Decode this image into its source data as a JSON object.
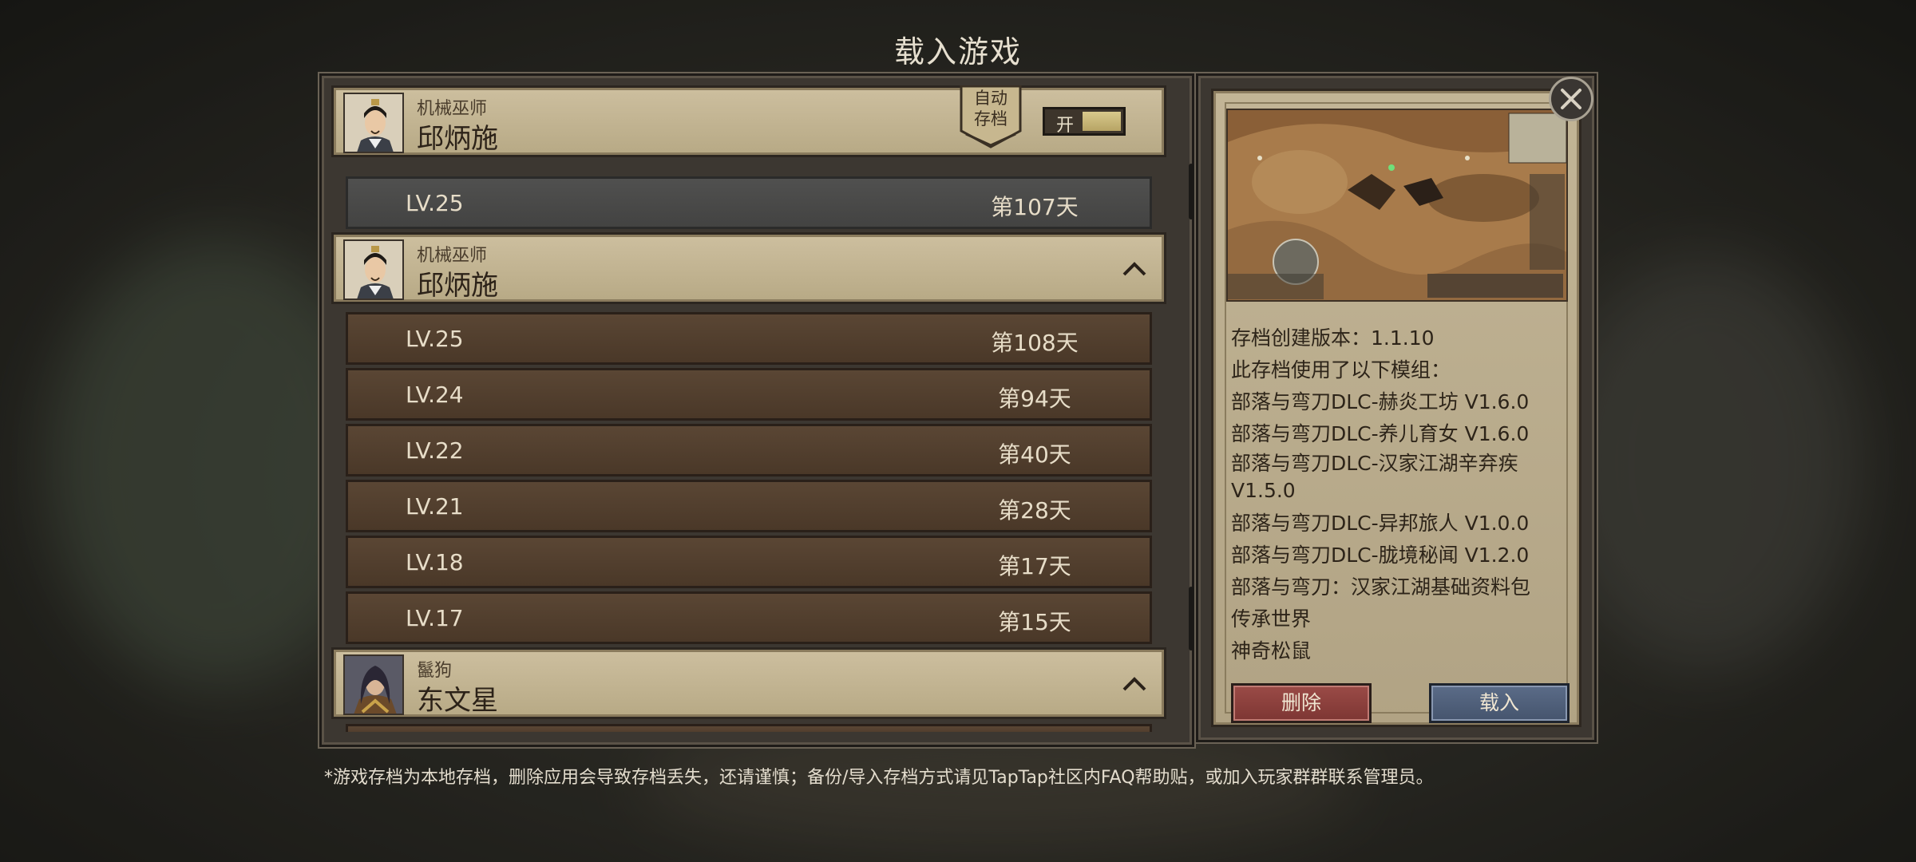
{
  "page": {
    "title": "载入游戏"
  },
  "save_list": {
    "groups": [
      {
        "char_class": "机械巫师",
        "char_name": "邱炳施",
        "autosave_label_1": "自动",
        "autosave_label_2": "存档",
        "toggle_label": "开",
        "saves": [
          {
            "level": "LV.25",
            "day": "第107天",
            "selected": true
          }
        ]
      },
      {
        "char_class": "机械巫师",
        "char_name": "邱炳施",
        "expanded": true,
        "saves": [
          {
            "level": "LV.25",
            "day": "第108天"
          },
          {
            "level": "LV.24",
            "day": "第94天"
          },
          {
            "level": "LV.22",
            "day": "第40天"
          },
          {
            "level": "LV.21",
            "day": "第28天"
          },
          {
            "level": "LV.18",
            "day": "第17天"
          },
          {
            "level": "LV.17",
            "day": "第15天"
          }
        ]
      },
      {
        "char_class": "鬣狗",
        "char_name": "东文星",
        "expanded": true,
        "saves": []
      }
    ]
  },
  "detail": {
    "version_line": "存档创建版本：1.1.10",
    "mods_heading": "此存档使用了以下模组：",
    "mods": [
      "部落与弯刀DLC-赫炎工坊 V1.6.0",
      "部落与弯刀DLC-养儿育女 V1.6.0",
      "部落与弯刀DLC-汉家江湖辛弃疾 V1.5.0",
      "部落与弯刀DLC-异邦旅人 V1.0.0",
      "部落与弯刀DLC-胧境秘闻 V1.2.0",
      "部落与弯刀：汉家江湖基础资料包",
      "传承世界",
      "神奇松鼠"
    ],
    "delete_label": "删除",
    "load_label": "载入"
  },
  "footnote": "*游戏存档为本地存档，删除应用会导致存档丢失，还请谨慎；备份/导入存档方式请见TapTap社区内FAQ帮助贴，或加入玩家群群联系管理员。",
  "colors": {
    "delete": "#8c403c",
    "load": "#4e5e7a",
    "panel": "#c2b596"
  }
}
